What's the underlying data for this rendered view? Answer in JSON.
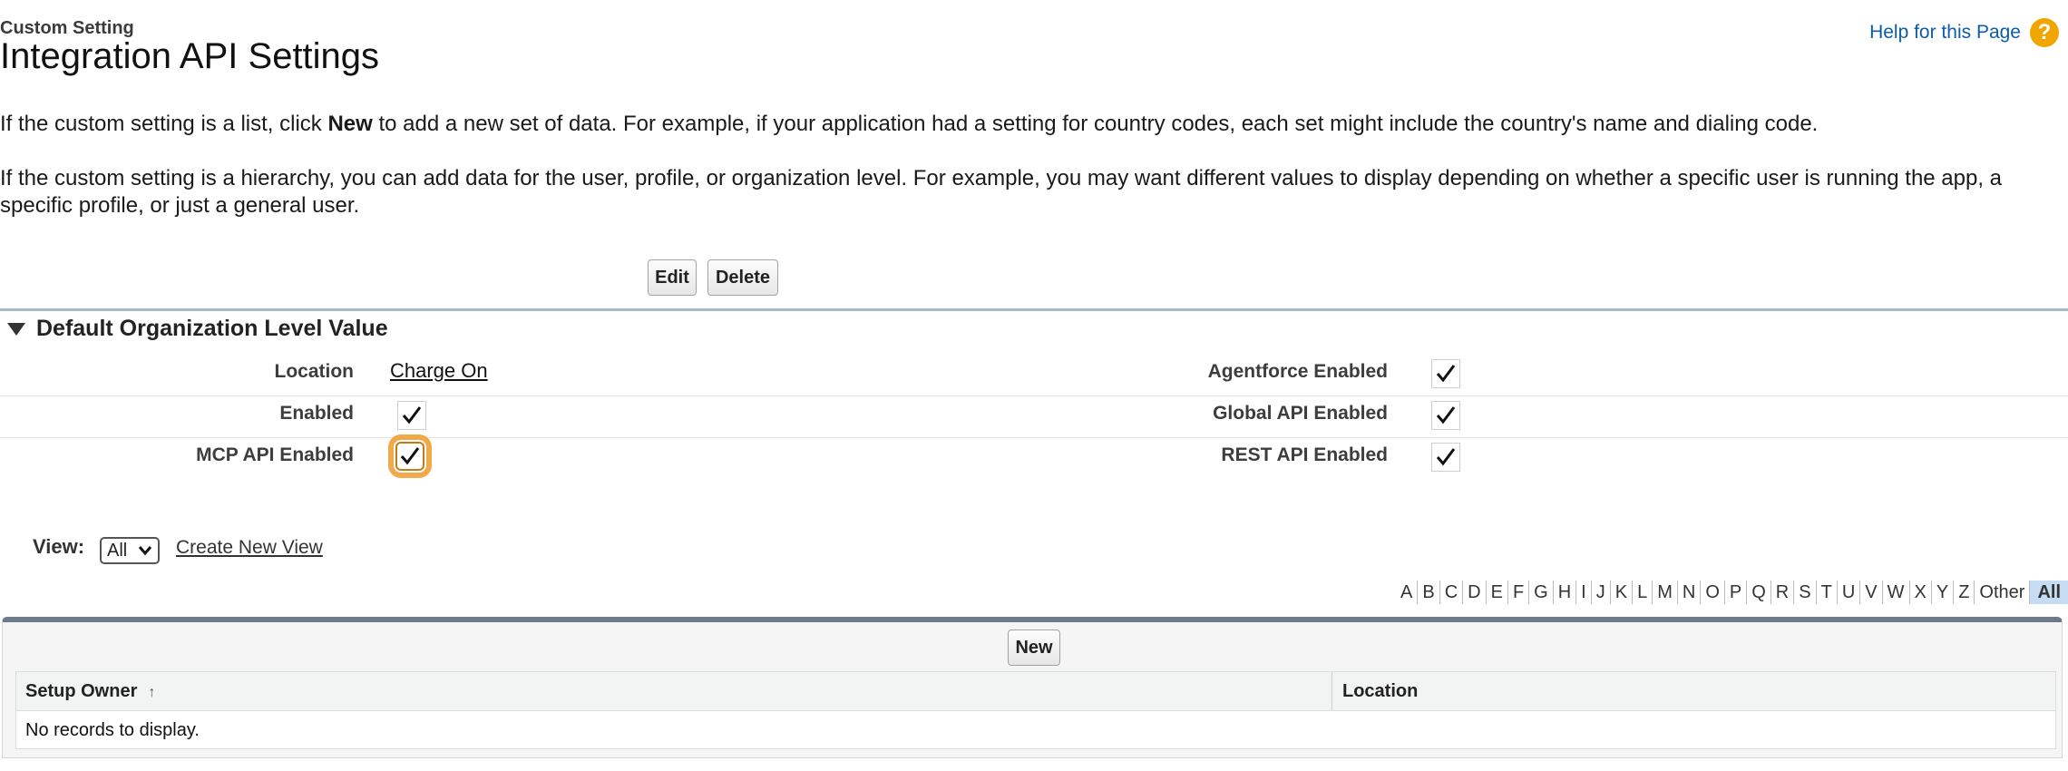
{
  "header": {
    "subtitle": "Custom Setting",
    "title": "Integration API Settings",
    "help_link": "Help for this Page",
    "help_icon": "?"
  },
  "intro": {
    "list_text_1": "If the custom setting is a list, click ",
    "list_bold": "New",
    "list_text_2": " to add a new set of data. For example, if your application had a setting for country codes, each set might include the country's name and dialing code.",
    "hierarchy_line1": "If the custom setting is a hierarchy, you can add data for the user, profile, or organization level. For example, you may want different values to display depending on whether a specific user is running the app, a",
    "hierarchy_line2": "specific profile, or just a general user."
  },
  "toolbar": {
    "edit_label": "Edit",
    "delete_label": "Delete"
  },
  "section": {
    "title": "Default Organization Level Value",
    "fields": {
      "location_label": "Location",
      "location_value": "Charge On",
      "enabled_label": "Enabled",
      "mcp_label": "MCP API Enabled",
      "agentforce_label": "Agentforce Enabled",
      "global_label": "Global API Enabled",
      "rest_label": "REST API Enabled"
    }
  },
  "view": {
    "label": "View:",
    "selected": "All",
    "create_link": "Create New View"
  },
  "alphabet": [
    "A",
    "B",
    "C",
    "D",
    "E",
    "F",
    "G",
    "H",
    "I",
    "J",
    "K",
    "L",
    "M",
    "N",
    "O",
    "P",
    "Q",
    "R",
    "S",
    "T",
    "U",
    "V",
    "W",
    "X",
    "Y",
    "Z",
    "Other",
    "All"
  ],
  "list": {
    "new_label": "New",
    "col_owner": "Setup Owner",
    "col_location": "Location",
    "sort_icon": "↑",
    "empty_text": "No records to display."
  },
  "colors": {
    "highlight": "#f2a94a",
    "link": "#0b5cab",
    "help_icon": "#f0a500"
  }
}
